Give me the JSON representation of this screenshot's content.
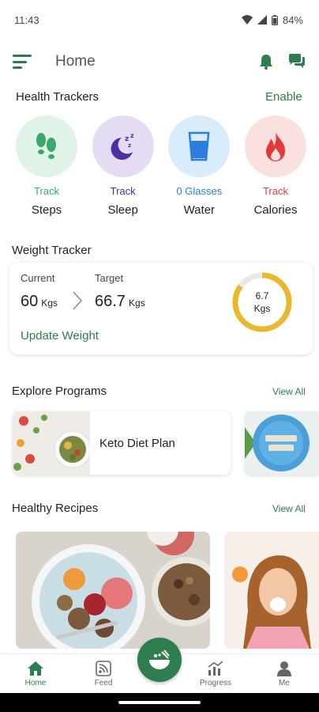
{
  "status_bar": {
    "time": "11:43",
    "battery": "84%"
  },
  "app_bar": {
    "title": "Home",
    "icons": [
      "menu-icon",
      "bell-icon",
      "chat-icon"
    ]
  },
  "health_trackers": {
    "title": "Health Trackers",
    "action": "Enable",
    "items": [
      {
        "name": "Steps",
        "status": "Track",
        "status_color": "#3aa86b",
        "bg": "#dff3e6",
        "icon": "footprints-icon"
      },
      {
        "name": "Sleep",
        "status": "Track",
        "status_color": "#4b2fa3",
        "bg": "#e5dcf3",
        "icon": "moon-icon"
      },
      {
        "name": "Water",
        "status": "0 Glasses",
        "status_color": "#2b7de0",
        "bg": "#d8ecfb",
        "icon": "glass-icon"
      },
      {
        "name": "Calories",
        "status": "Track",
        "status_color": "#e23a3a",
        "bg": "#fbe0e0",
        "icon": "flame-icon"
      }
    ]
  },
  "weight_tracker": {
    "title": "Weight Tracker",
    "current_label": "Current",
    "current_value": "60",
    "current_unit": "Kgs",
    "target_label": "Target",
    "target_value": "66.7",
    "target_unit": "Kgs",
    "ring_value": "6.7",
    "ring_unit": "Kgs",
    "ring_fraction": 0.85,
    "update_link": "Update Weight",
    "ring_color": "#e8b92e"
  },
  "explore_programs": {
    "title": "Explore Programs",
    "view_all": "View All",
    "items": [
      {
        "name": "Keto Diet Plan"
      }
    ]
  },
  "healthy_recipes": {
    "title": "Healthy Recipes",
    "view_all": "View All"
  },
  "bottom_nav": {
    "items": [
      {
        "label": "Home",
        "icon": "home-icon",
        "active": true
      },
      {
        "label": "Feed",
        "icon": "feed-icon",
        "active": false
      },
      {
        "label": "Progress",
        "icon": "progress-icon",
        "active": false
      },
      {
        "label": "Me",
        "icon": "person-icon",
        "active": false
      }
    ],
    "fab_icon": "bowl-icon"
  },
  "colors": {
    "accent": "#2e7d4f"
  }
}
